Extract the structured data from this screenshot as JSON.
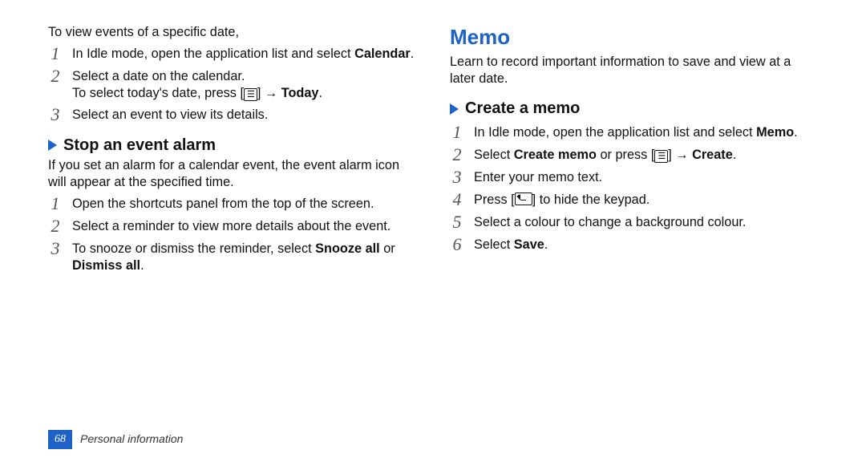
{
  "left": {
    "intro": "To view events of a specific date,",
    "steps_a": [
      {
        "n": "1",
        "pre": "In Idle mode, open the application list and select ",
        "bold": "Calendar",
        "post": "."
      },
      {
        "n": "2",
        "pre": "Select a date on the calendar.",
        "line2_pre": "To select today's date, press [",
        "line2_icon": "menu",
        "line2_mid": "] → ",
        "line2_bold": "Today",
        "line2_post": "."
      },
      {
        "n": "3",
        "pre": "Select an event to view its details."
      }
    ],
    "h2": "Stop an event alarm",
    "desc": "If you set an alarm for a calendar event, the event alarm icon will appear at the specified time.",
    "steps_b": [
      {
        "n": "1",
        "pre": "Open the shortcuts panel from the top of the screen."
      },
      {
        "n": "2",
        "pre": "Select a reminder to view more details about the event."
      },
      {
        "n": "3",
        "pre": "To snooze or dismiss the reminder, select ",
        "bold": "Snooze all",
        "mid": " or ",
        "bold2": "Dismiss all",
        "post": "."
      }
    ]
  },
  "right": {
    "h1": "Memo",
    "desc": "Learn to record important information to save and view at a later date.",
    "h2": "Create a memo",
    "steps": [
      {
        "n": "1",
        "pre": "In Idle mode, open the application list and select ",
        "bold": "Memo",
        "post": "."
      },
      {
        "n": "2",
        "pre": "Select ",
        "bold": "Create memo",
        "mid": " or press [",
        "icon": "menu",
        "mid2": "] → ",
        "bold2": "Create",
        "post": "."
      },
      {
        "n": "3",
        "pre": "Enter your memo text."
      },
      {
        "n": "4",
        "pre": "Press [",
        "icon": "back",
        "mid": "] to hide the keypad."
      },
      {
        "n": "5",
        "pre": "Select a colour to change a background colour."
      },
      {
        "n": "6",
        "pre": "Select ",
        "bold": "Save",
        "post": "."
      }
    ]
  },
  "footer": {
    "page": "68",
    "section": "Personal information"
  },
  "glyphs": {
    "menu": "☰"
  }
}
